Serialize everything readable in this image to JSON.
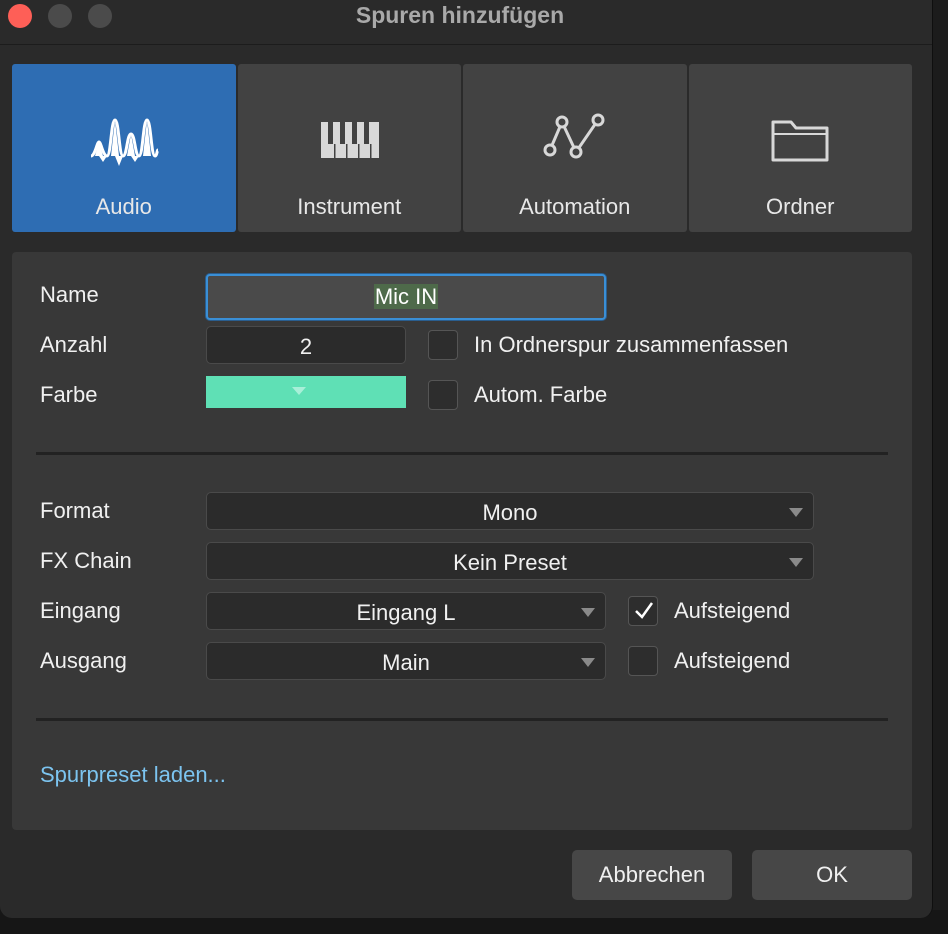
{
  "window": {
    "title": "Spuren hinzufügen"
  },
  "tabs": [
    {
      "label": "Audio",
      "icon": "audio-waveform-icon",
      "active": true
    },
    {
      "label": "Instrument",
      "icon": "piano-keys-icon",
      "active": false
    },
    {
      "label": "Automation",
      "icon": "automation-curve-icon",
      "active": false
    },
    {
      "label": "Ordner",
      "icon": "folder-icon",
      "active": false
    }
  ],
  "form": {
    "name_label": "Name",
    "name_value": "Mic IN",
    "count_label": "Anzahl",
    "count_value": "2",
    "folder_checkbox_label": "In Ordnerspur zusammenfassen",
    "folder_checkbox_checked": false,
    "color_label": "Farbe",
    "color_value": "#5fe0b5",
    "auto_color_label": "Autom. Farbe",
    "auto_color_checked": false,
    "format_label": "Format",
    "format_value": "Mono",
    "fx_label": "FX Chain",
    "fx_value": "Kein Preset",
    "input_label": "Eingang",
    "input_value": "Eingang L",
    "input_ascending_label": "Aufsteigend",
    "input_ascending_checked": true,
    "output_label": "Ausgang",
    "output_value": "Main",
    "output_ascending_label": "Aufsteigend",
    "output_ascending_checked": false
  },
  "link": {
    "load_preset": "Spurpreset laden..."
  },
  "buttons": {
    "cancel": "Abbrechen",
    "ok": "OK"
  },
  "colors": {
    "accent": "#2e6db3",
    "link": "#7cc4f0",
    "close": "#fe5f57"
  }
}
